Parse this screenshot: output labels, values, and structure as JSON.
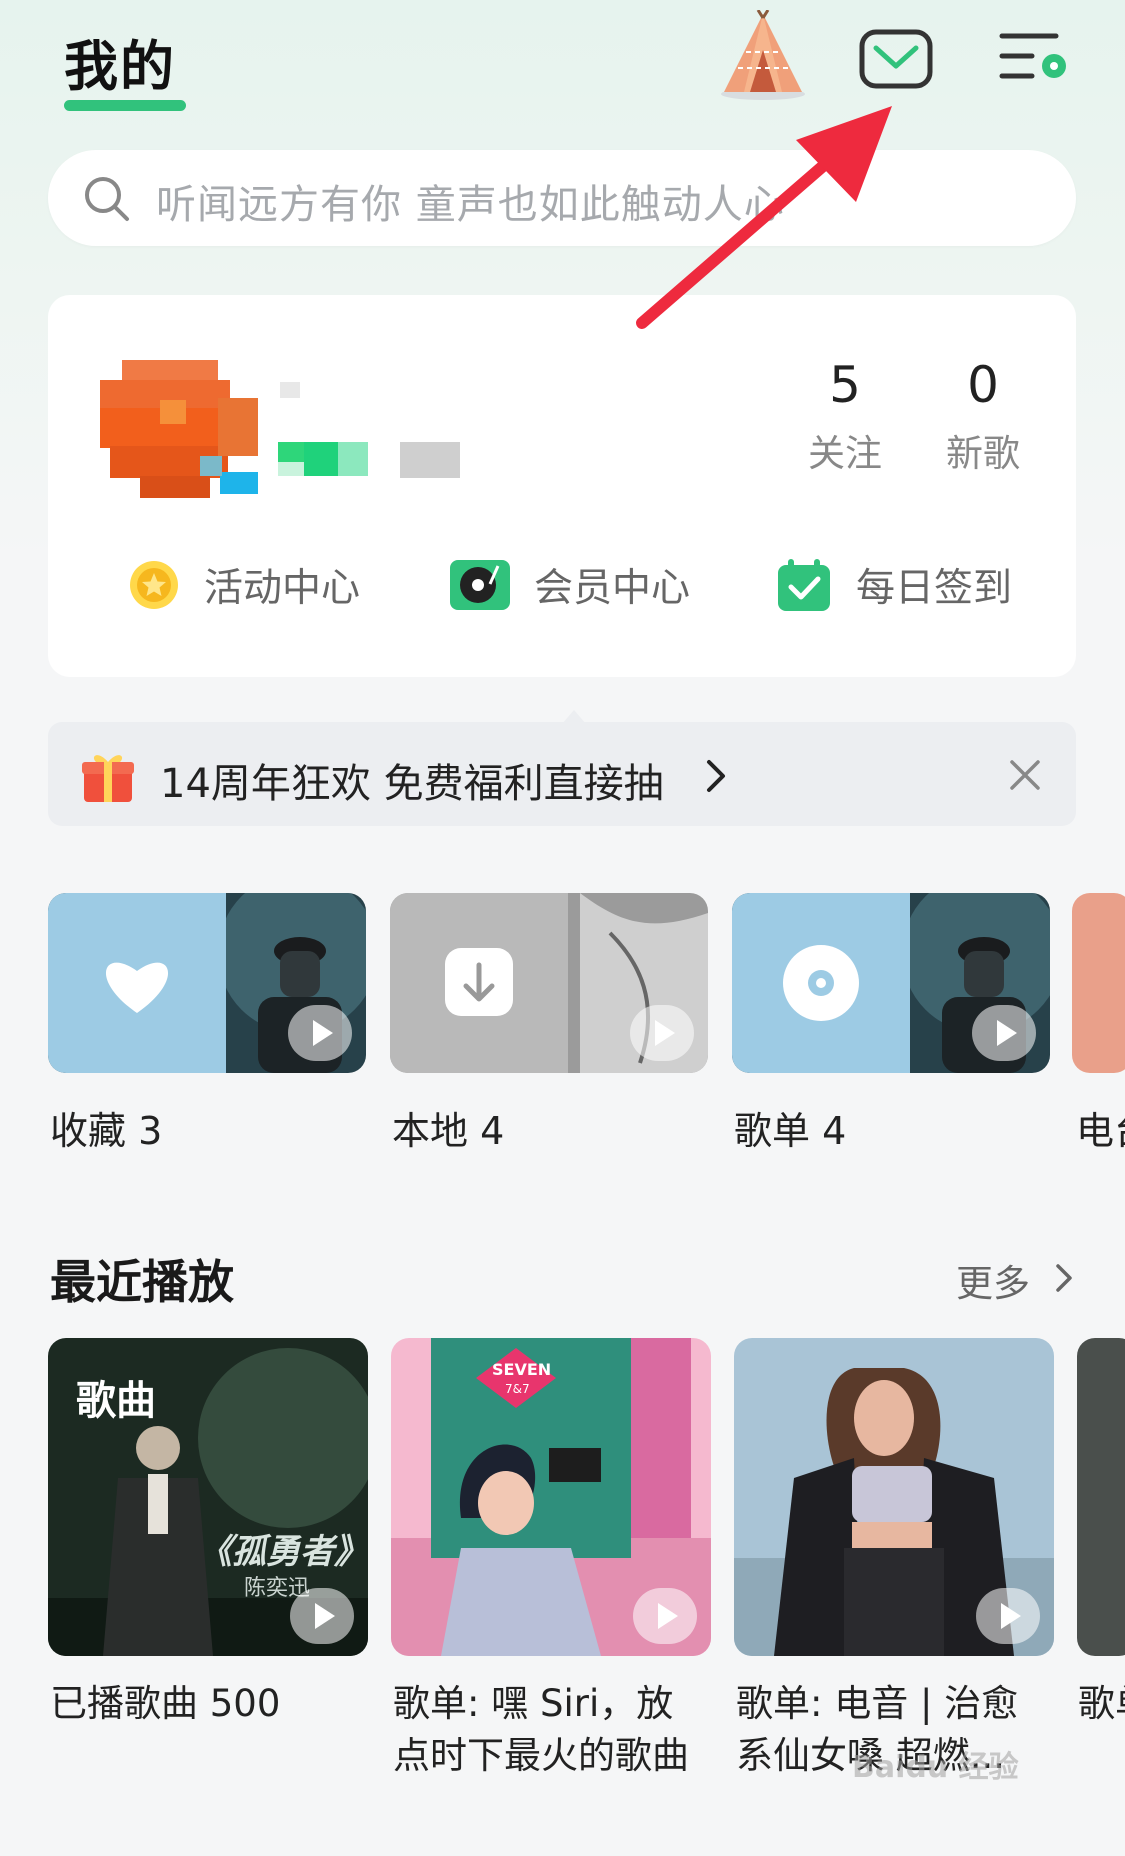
{
  "header": {
    "title": "我的"
  },
  "search": {
    "placeholder": "听闻远方有你  童声也如此触动人心"
  },
  "profile": {
    "stats": [
      {
        "value": "5",
        "label": "关注"
      },
      {
        "value": "0",
        "label": "新歌"
      }
    ],
    "quick_links": [
      {
        "label": "活动中心",
        "icon": "medal-icon"
      },
      {
        "label": "会员中心",
        "icon": "vinyl-player-icon"
      },
      {
        "label": "每日签到",
        "icon": "calendar-check-icon"
      }
    ]
  },
  "notice": {
    "text": "14周年狂欢 免费福利直接抽"
  },
  "library": [
    {
      "label": "收藏  3",
      "icon": "heart-icon"
    },
    {
      "label": "本地  4",
      "icon": "download-icon"
    },
    {
      "label": "歌单  4",
      "icon": "disc-icon"
    },
    {
      "label": "电台"
    }
  ],
  "recent": {
    "title": "最近播放",
    "more": "更多",
    "items": [
      {
        "badge": "歌曲",
        "cover_text": "《孤勇者》",
        "cover_sub": "陈奕迅",
        "line1": "已播歌曲 500",
        "line2": ""
      },
      {
        "cover_text": "SEVEN",
        "cover_sub": "7&7",
        "line1": "歌单: 嘿 Siri，放",
        "line2": "点时下最火的歌曲"
      },
      {
        "line1": "歌单: 电音 | 治愈",
        "line2": "系仙女嗓 超燃..."
      },
      {
        "line1": "歌单",
        "line2": ""
      }
    ]
  },
  "watermark": "Baidu 经验",
  "colors": {
    "accent": "#31c27c",
    "arrow": "#ee2a3e"
  }
}
